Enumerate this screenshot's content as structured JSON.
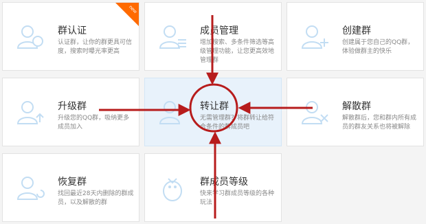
{
  "cards": [
    {
      "title": "群认证",
      "desc": "认证群，让你的群更具可信度，搜索时曝光率更高",
      "badge": "new"
    },
    {
      "title": "成员管理",
      "desc": "增加搜索、多条件筛选等高级管理功能，让您更高效地管理群"
    },
    {
      "title": "创建群",
      "desc": "创建属于您自己的QQ群，体验做群主的快乐"
    },
    {
      "title": "升级群",
      "desc": "升级您的QQ群，吸纳更多成员加入"
    },
    {
      "title": "转让群",
      "desc": "无需管理群？将群转让给符合条件的群成员吧"
    },
    {
      "title": "解散群",
      "desc": "解散群后，您和群内所有成员的群友关系也将被解除"
    },
    {
      "title": "恢复群",
      "desc": "找回最近28天内删除的群成员，以及解散的群"
    },
    {
      "title": "群成员等级",
      "desc": "快来学习群成员等级的各种玩法"
    }
  ],
  "colors": {
    "accent": "#b71c1c",
    "highlight": "#e8f2fb",
    "badge": "#ff6a00"
  }
}
